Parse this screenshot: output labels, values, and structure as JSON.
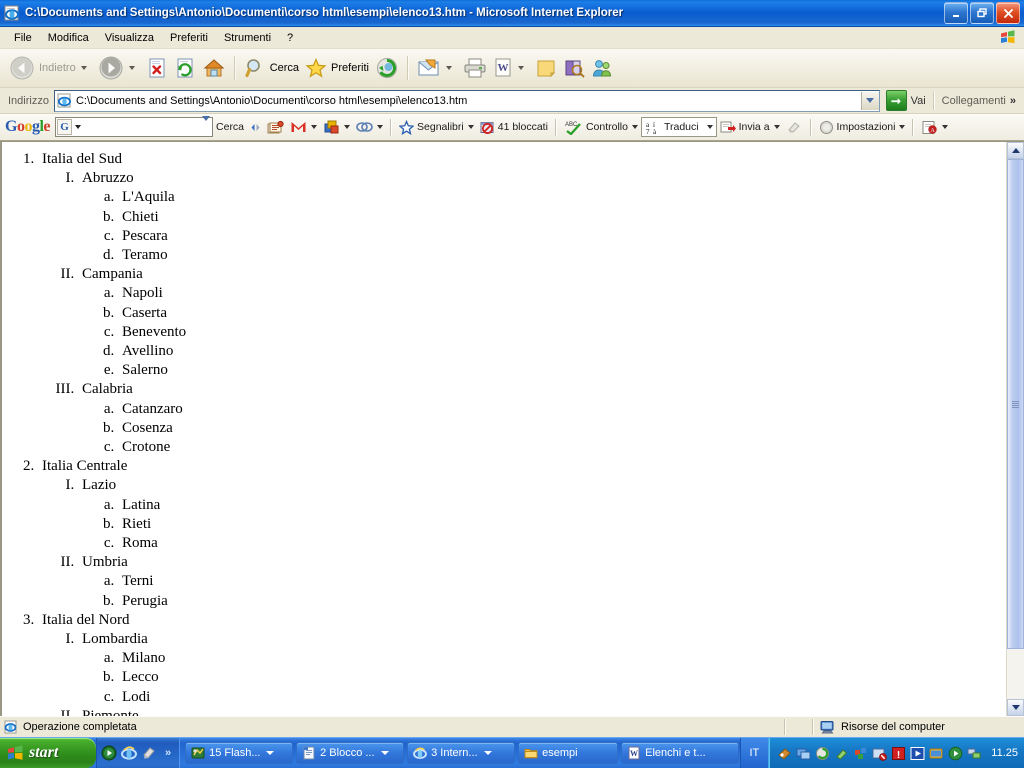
{
  "window": {
    "title": "C:\\Documents and Settings\\Antonio\\Documenti\\corso html\\esempi\\elenco13.htm - Microsoft Internet Explorer",
    "minimize_label": "_",
    "maximize_label": "❐",
    "close_label": "✕"
  },
  "menu": {
    "items": [
      {
        "label": "File"
      },
      {
        "label": "Modifica"
      },
      {
        "label": "Visualizza"
      },
      {
        "label": "Preferiti"
      },
      {
        "label": "Strumenti"
      },
      {
        "label": "?"
      }
    ]
  },
  "toolbar": {
    "back_label": "Indietro",
    "forward_label": "",
    "search_label": "Cerca",
    "favorites_label": "Preferiti"
  },
  "address": {
    "label": "Indirizzo",
    "value": "C:\\Documents and Settings\\Antonio\\Documenti\\corso html\\esempi\\elenco13.htm",
    "go_label": "Vai",
    "links_label": "Collegamenti",
    "overflow_label": "»"
  },
  "google_toolbar": {
    "logo": {
      "g1": "G",
      "o1": "o",
      "o2": "o",
      "g2": "g",
      "l": "l",
      "e": "e"
    },
    "search_value": "",
    "search_engine_letter": "G",
    "search_label": "Cerca",
    "bookmarks_label": "Segnalibri",
    "blocked_label": "41 bloccati",
    "spellcheck_label": "Controllo",
    "translate_label": "Traduci",
    "translate_icon_text": "a i\n7 a",
    "sendto_label": "Invia a",
    "settings_label": "Impostazioni"
  },
  "content": {
    "list": [
      {
        "label": "Italia del Sud",
        "children": [
          {
            "label": "Abruzzo",
            "children": [
              {
                "label": "L'Aquila"
              },
              {
                "label": "Chieti"
              },
              {
                "label": "Pescara"
              },
              {
                "label": "Teramo"
              }
            ]
          },
          {
            "label": "Campania",
            "children": [
              {
                "label": "Napoli"
              },
              {
                "label": "Caserta"
              },
              {
                "label": "Benevento"
              },
              {
                "label": "Avellino"
              },
              {
                "label": "Salerno"
              }
            ]
          },
          {
            "label": "Calabria",
            "children": [
              {
                "label": "Catanzaro"
              },
              {
                "label": "Cosenza"
              },
              {
                "label": "Crotone"
              }
            ]
          }
        ]
      },
      {
        "label": "Italia Centrale",
        "children": [
          {
            "label": "Lazio",
            "children": [
              {
                "label": "Latina"
              },
              {
                "label": "Rieti"
              },
              {
                "label": "Roma"
              }
            ]
          },
          {
            "label": "Umbria",
            "children": [
              {
                "label": "Terni"
              },
              {
                "label": "Perugia"
              }
            ]
          }
        ]
      },
      {
        "label": "Italia del Nord",
        "children": [
          {
            "label": "Lombardia",
            "children": [
              {
                "label": "Milano"
              },
              {
                "label": "Lecco"
              },
              {
                "label": "Lodi"
              }
            ]
          },
          {
            "label": "Piemonte",
            "children": []
          }
        ]
      }
    ]
  },
  "statusbar": {
    "message": "Operazione completata",
    "zone": "Risorse del computer"
  },
  "taskbar": {
    "start_label": "start",
    "tasks": [
      {
        "label": "15 Flash...",
        "has_dropdown": true,
        "icon": "flash-icon"
      },
      {
        "label": "2 Blocco ...",
        "has_dropdown": true,
        "icon": "notepad-icon"
      },
      {
        "label": "3 Intern...",
        "has_dropdown": true,
        "icon": "ie-icon"
      },
      {
        "label": "esempi",
        "has_dropdown": false,
        "icon": "folder-icon"
      },
      {
        "label": "Elenchi e t...",
        "has_dropdown": false,
        "icon": "word-icon"
      }
    ],
    "language": "IT",
    "clock": "11.25"
  },
  "colors": {
    "titlebar_blue": "#0a5dd0",
    "taskbar_blue": "#2264ce",
    "start_green": "#2f8d1c",
    "chrome_beige": "#ece9d8"
  }
}
